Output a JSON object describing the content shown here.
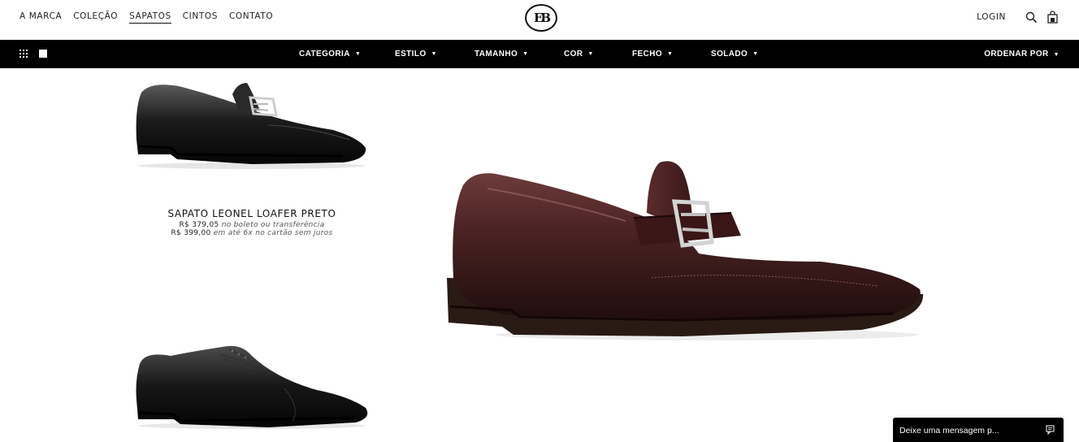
{
  "header": {
    "nav": [
      "A MARCA",
      "COLEÇÃO",
      "SAPATOS",
      "CINTOS",
      "CONTATO"
    ],
    "logo_text": "EB",
    "login": "LOGIN"
  },
  "filterbar": {
    "filters": [
      "CATEGORIA",
      "ESTILO",
      "TAMANHO",
      "COR",
      "FECHO",
      "SOLADO"
    ],
    "sort": "ORDENAR POR",
    "caret": "▼"
  },
  "products": [
    {
      "name": "SAPATO LEONEL LOAFER PRETO",
      "price_boleto": "R$ 379,05",
      "price_boleto_note": "no boleto ou transferência",
      "price_card": "R$ 399,00",
      "price_card_note": "em até 6x no cartão sem juros"
    }
  ],
  "chat": {
    "label": "Deixe uma mensagem p..."
  },
  "colors": {
    "accent": "#000000",
    "featured_leather": "#3e1c1c"
  }
}
